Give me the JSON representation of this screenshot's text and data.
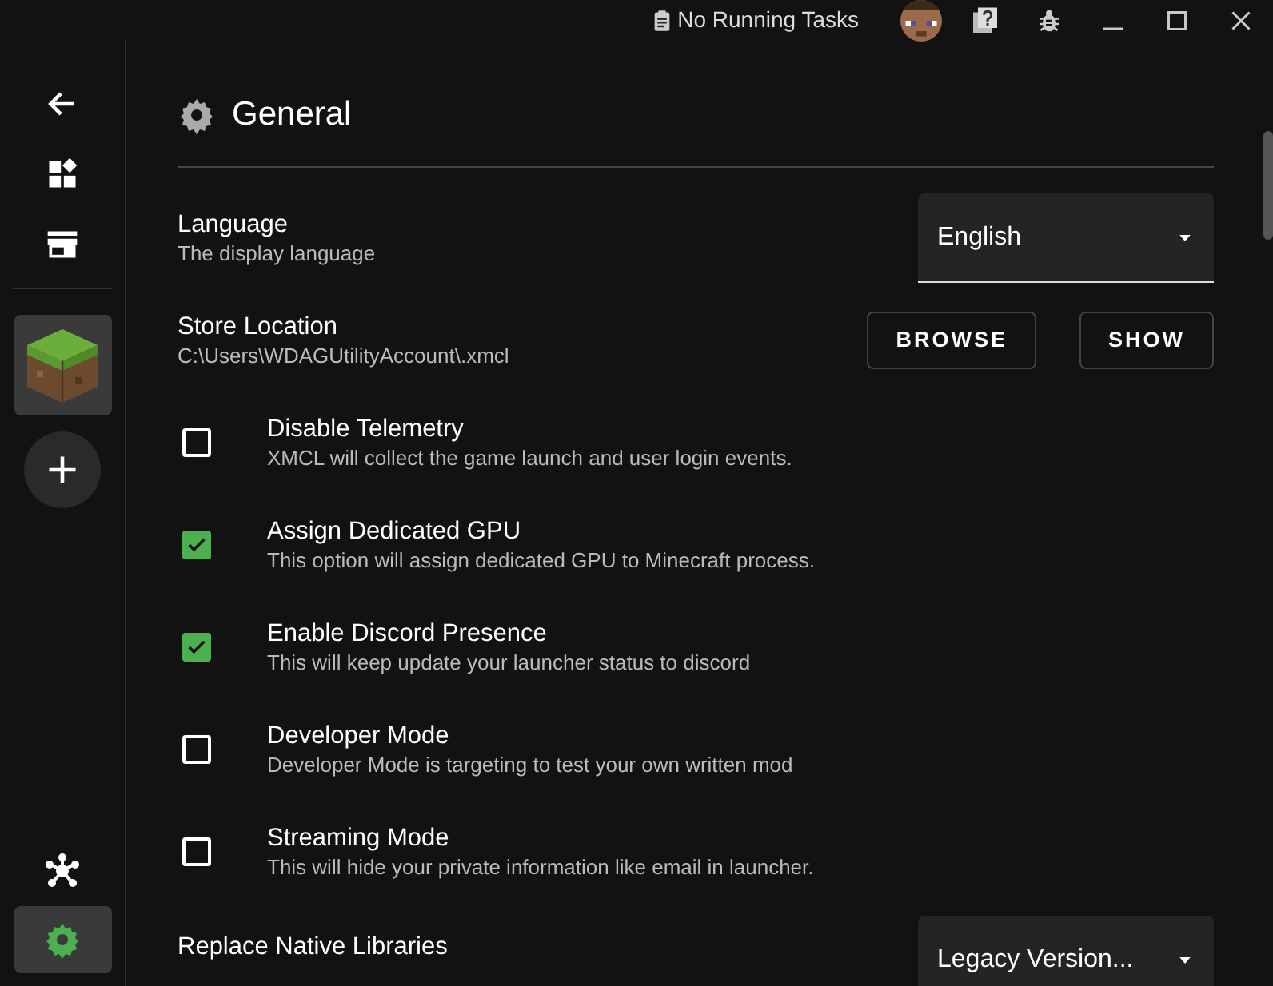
{
  "title_bar": {
    "tasks": "No Running Tasks"
  },
  "sidebar": {
    "items": [
      {
        "kind": "back"
      },
      {
        "kind": "grid"
      },
      {
        "kind": "store"
      },
      {
        "kind": "instance",
        "selected": false
      },
      {
        "kind": "add"
      }
    ],
    "bottom_items": [
      {
        "kind": "network",
        "selected": false
      },
      {
        "kind": "settings",
        "selected": true
      }
    ]
  },
  "section": {
    "title": "General"
  },
  "settings": [
    {
      "kind": "select",
      "title": "Language",
      "description": "The display language",
      "value": "English"
    },
    {
      "kind": "buttons",
      "title": "Store Location",
      "description": "C:\\Users\\WDAGUtilityAccount\\.xmcl",
      "buttons": [
        "BROWSE",
        "SHOW"
      ]
    },
    {
      "kind": "checkbox",
      "title": "Disable Telemetry",
      "description": "XMCL will collect the game launch and user login events.",
      "checked": false
    },
    {
      "kind": "checkbox",
      "title": "Assign Dedicated GPU",
      "description": "This option will assign dedicated GPU to Minecraft process.",
      "checked": true
    },
    {
      "kind": "checkbox",
      "title": "Enable Discord Presence",
      "description": "This will keep update your launcher status to discord",
      "checked": true
    },
    {
      "kind": "checkbox",
      "title": "Developer Mode",
      "description": "Developer Mode is targeting to test your own written mod",
      "checked": false
    },
    {
      "kind": "checkbox",
      "title": "Streaming Mode",
      "description": "This will hide your private information like email in launcher.",
      "checked": false
    },
    {
      "kind": "select",
      "title": "Replace Native Libraries",
      "value": "Legacy Version..."
    }
  ]
}
